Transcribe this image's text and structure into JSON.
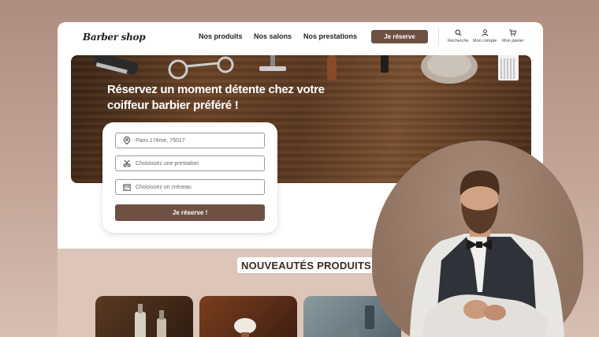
{
  "header": {
    "logo": "Barber shop",
    "nav": [
      "Nos produits",
      "Nos salons",
      "Nos prestations"
    ],
    "cta": "Je réserve",
    "utilities": [
      {
        "label": "Recherche",
        "icon": "search-icon"
      },
      {
        "label": "Mon compte",
        "icon": "user-icon"
      },
      {
        "label": "Mon panier",
        "icon": "cart-icon"
      }
    ]
  },
  "hero": {
    "title": "Réservez un moment détente chez votre coiffeur barbier préféré !"
  },
  "booking": {
    "location_value": "Paris 17ème, 75017",
    "service_placeholder": "Choisissez une prestation",
    "slot_placeholder": "Choisissez un créneau",
    "submit": "Je réserve !"
  },
  "products": {
    "title": "NOUVEAUTÉS PRODUITS"
  },
  "colors": {
    "accent": "#6f5143",
    "background": "#c4a698",
    "section": "#dcc6b9"
  }
}
